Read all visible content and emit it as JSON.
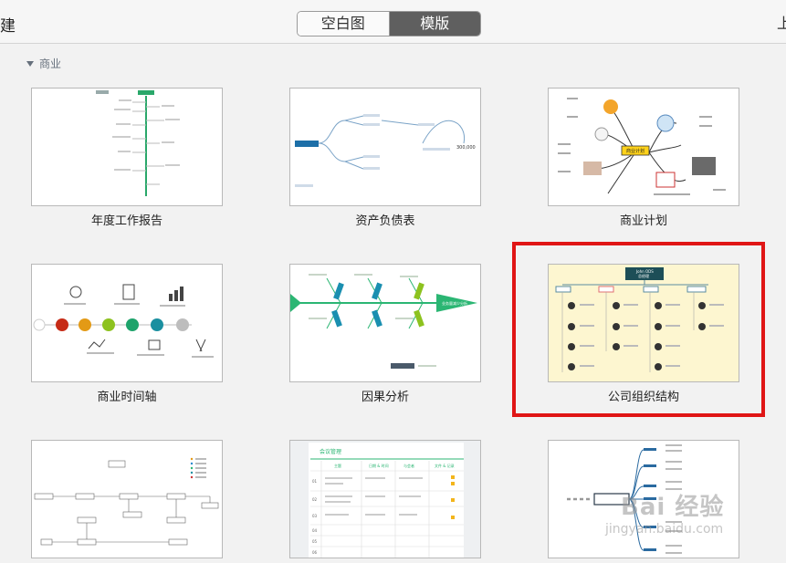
{
  "header": {
    "partial_title": "建",
    "tabs": [
      {
        "label": "空白图",
        "active": false
      },
      {
        "label": "模版",
        "active": true
      }
    ],
    "right_partial": "上"
  },
  "category": {
    "label": "商业"
  },
  "templates": [
    {
      "label": "年度工作报告"
    },
    {
      "label": "资产负债表"
    },
    {
      "label": "商业计划"
    },
    {
      "label": "商业时间轴"
    },
    {
      "label": "因果分析"
    },
    {
      "label": "公司组织结构",
      "selected": true
    },
    {
      "label": ""
    },
    {
      "label": ""
    },
    {
      "label": ""
    }
  ],
  "thumb_texts": {
    "meeting_title": "会议管理",
    "meeting_cols": [
      "主题",
      "日期 & 时间",
      "与会者",
      "文件 & 记录"
    ],
    "meeting_rows": [
      "01",
      "02",
      "03",
      "04",
      "05",
      "06"
    ],
    "plan_center": "商业计划",
    "org_top": "John ODS",
    "org_top_sub": "总经理",
    "asset_value": "300,000",
    "fish_head": "业务量减少分析"
  },
  "watermark": {
    "line1": "Bai 经验",
    "line2": "jingyan.baidu.com"
  },
  "colors": {
    "selection": "#e01616",
    "active_tab": "#5f5f5f",
    "org_header": "#1d4e57"
  }
}
